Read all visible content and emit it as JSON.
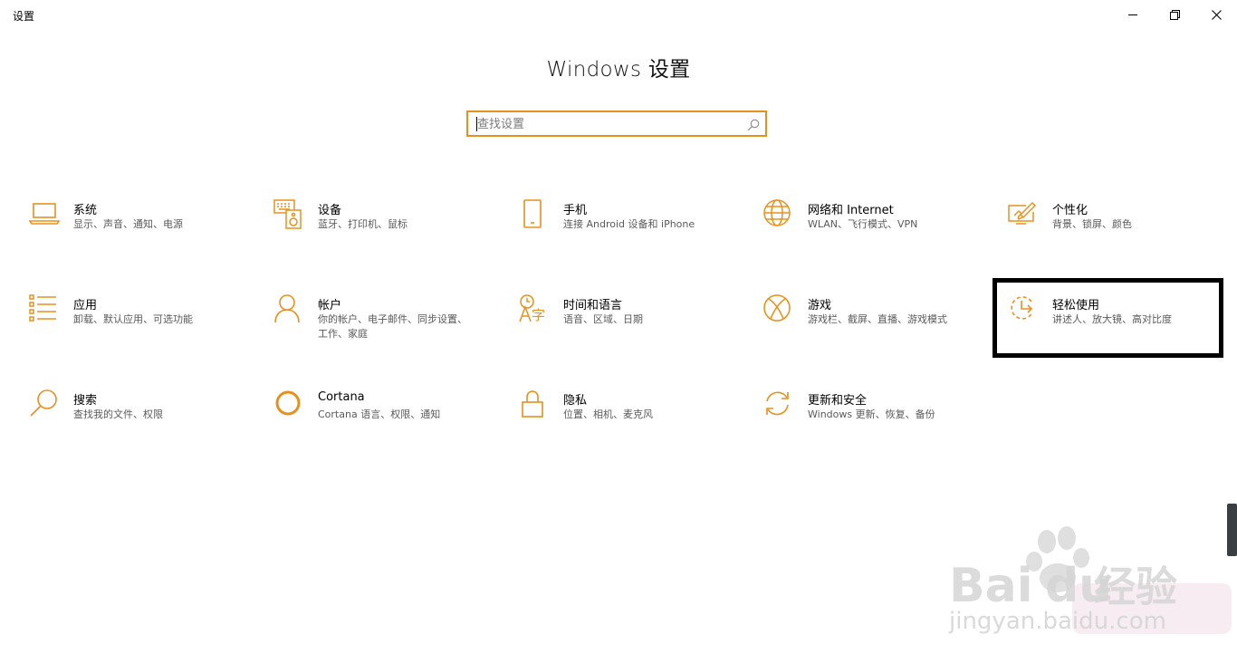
{
  "window": {
    "app_title": "设置",
    "controls": [
      "minimize-icon",
      "restore-icon",
      "close-icon"
    ]
  },
  "page_title": "Windows 设置",
  "search": {
    "placeholder": "查找设置",
    "value": ""
  },
  "tiles": [
    {
      "name": "系统",
      "desc": "显示、声音、通知、电源",
      "icon": "laptop-icon"
    },
    {
      "name": "设备",
      "desc": "蓝牙、打印机、鼠标",
      "icon": "keyboard-speaker-icon"
    },
    {
      "name": "手机",
      "desc": "连接 Android 设备和 iPhone",
      "icon": "phone-icon"
    },
    {
      "name": "网络和 Internet",
      "desc": "WLAN、飞行模式、VPN",
      "icon": "globe-icon"
    },
    {
      "name": "个性化",
      "desc": "背景、锁屏、颜色",
      "icon": "paint-icon"
    },
    {
      "name": "应用",
      "desc": "卸载、默认应用、可选功能",
      "icon": "apps-list-icon"
    },
    {
      "name": "帐户",
      "desc": "你的帐户、电子邮件、同步设置、工作、家庭",
      "icon": "person-icon"
    },
    {
      "name": "时间和语言",
      "desc": "语音、区域、日期",
      "icon": "time-language-icon"
    },
    {
      "name": "游戏",
      "desc": "游戏栏、截屏、直播、游戏模式",
      "icon": "xbox-icon"
    },
    {
      "name": "轻松使用",
      "desc": "讲述人、放大镜、高对比度",
      "icon": "ease-of-access-icon"
    },
    {
      "name": "搜索",
      "desc": "查找我的文件、权限",
      "icon": "magnifier-icon"
    },
    {
      "name": "Cortana",
      "desc": "Cortana 语言、权限、通知",
      "icon": "cortana-icon"
    },
    {
      "name": "隐私",
      "desc": "位置、相机、麦克风",
      "icon": "lock-icon"
    },
    {
      "name": "更新和安全",
      "desc": "Windows 更新、恢复、备份",
      "icon": "sync-icon"
    }
  ],
  "watermark": {
    "brand": "Bai",
    "brand_tail": "du",
    "cn": "经验",
    "url": "jingyan.baidu.com"
  },
  "accent_color": "#e8901d"
}
